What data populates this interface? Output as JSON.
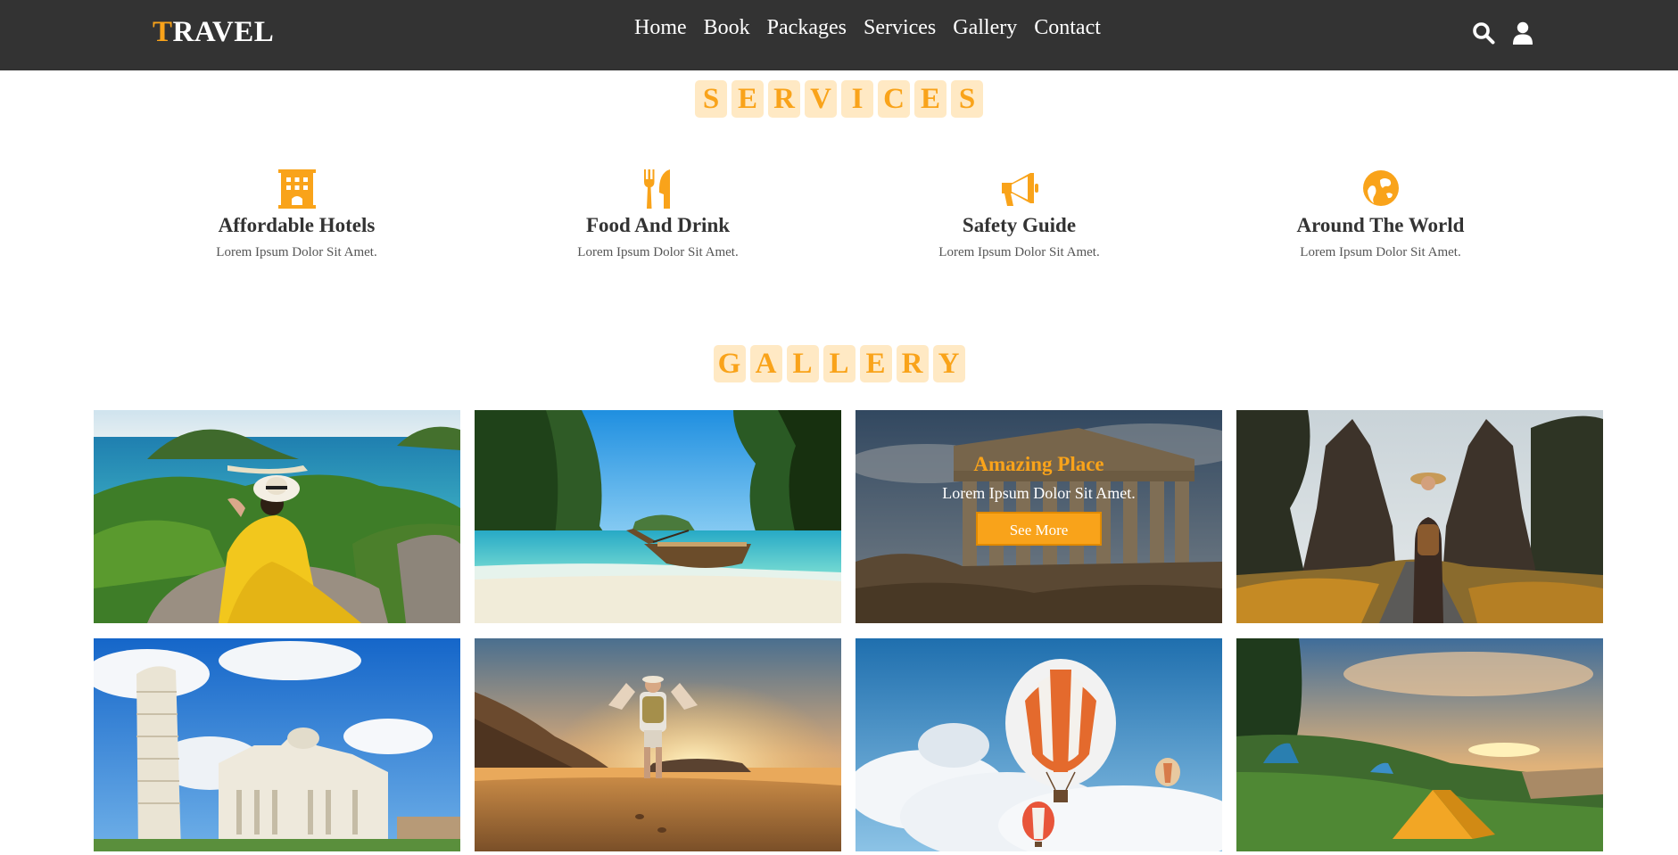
{
  "brand": {
    "logo_first": "T",
    "logo_rest": "RAVEL",
    "accent": "#f9a31a",
    "nav_bg": "#333333"
  },
  "nav": {
    "links": [
      "Home",
      "Book",
      "Packages",
      "Services",
      "Gallery",
      "Contact"
    ],
    "icons": [
      "search-icon",
      "user-icon"
    ]
  },
  "services": {
    "heading": [
      "S",
      "E",
      "R",
      "V",
      "I",
      "C",
      "E",
      "S"
    ],
    "items": [
      {
        "icon": "hotel-icon",
        "title": "Affordable Hotels",
        "text": "Lorem Ipsum Dolor Sit Amet."
      },
      {
        "icon": "utensils-icon",
        "title": "Food And Drink",
        "text": "Lorem Ipsum Dolor Sit Amet."
      },
      {
        "icon": "bullhorn-icon",
        "title": "Safety Guide",
        "text": "Lorem Ipsum Dolor Sit Amet."
      },
      {
        "icon": "globe-icon",
        "title": "Around The World",
        "text": "Lorem Ipsum Dolor Sit Amet."
      }
    ]
  },
  "gallery": {
    "heading": [
      "G",
      "A",
      "L",
      "L",
      "E",
      "R",
      "Y"
    ],
    "overlay": {
      "title": "Amazing Place",
      "text": "Lorem Ipsum Dolor Sit Amet.",
      "button": "See More"
    },
    "images": [
      "woman-in-yellow-dress-coast-photo",
      "longtail-boat-beach-photo",
      "ancient-temple-ruins-photo",
      "temple-gate-traveler-photo",
      "leaning-tower-pisa-photo",
      "beach-sunset-hiker-photo",
      "hot-air-balloons-photo",
      "camping-tents-sunset-photo"
    ]
  }
}
